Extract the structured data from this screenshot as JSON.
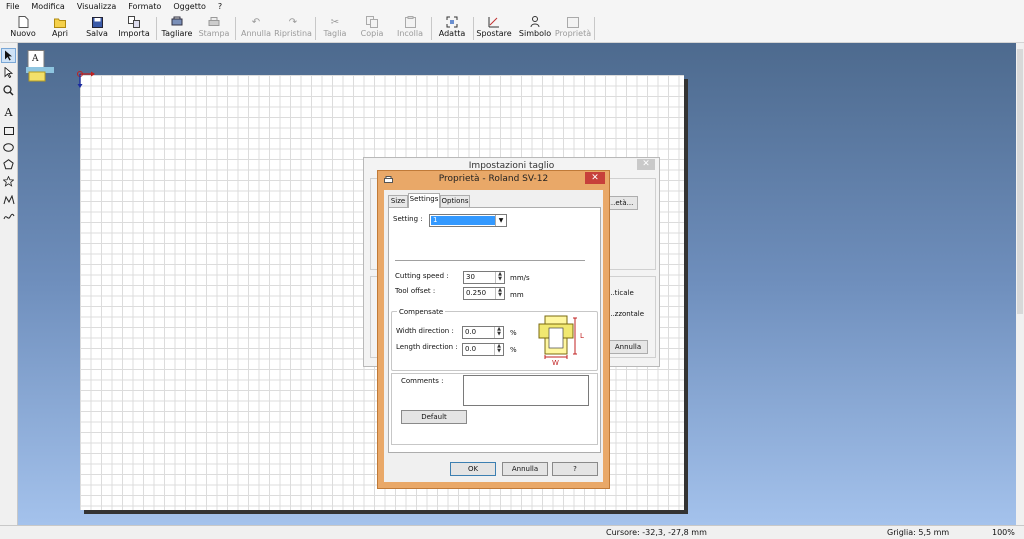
{
  "menu": [
    "File",
    "Modifica",
    "Visualizza",
    "Formato",
    "Oggetto",
    "?"
  ],
  "toolbar": {
    "nuovo": "Nuovo",
    "apri": "Apri",
    "salva": "Salva",
    "importa": "Importa",
    "tagliare": "Tagliare",
    "stampa": "Stampa",
    "annulla": "Annulla",
    "ripristina": "Ripristina",
    "taglia": "Taglia",
    "copia": "Copia",
    "incolla": "Incolla",
    "adatta": "Adatta",
    "spostare": "Spostare",
    "simbolo": "Simbolo",
    "proprieta": "Proprietà"
  },
  "left_tools": [
    "select-arrow-icon",
    "node-edit-icon",
    "zoom-icon",
    "text-icon",
    "rectangle-icon",
    "ellipse-icon",
    "polygon-icon",
    "star-icon",
    "bezier-icon",
    "freehand-icon"
  ],
  "back_dialog": {
    "title": "Impostazioni taglio",
    "close": "✕",
    "properties_button": "...età...",
    "vertical_label": "...ticale",
    "horizontal_label": "...zzontale",
    "cancel_button": "Annulla"
  },
  "front_dialog": {
    "title": "Proprietà - Roland SV-12",
    "close": "✕",
    "tabs": [
      "Size",
      "Settings",
      "Options"
    ],
    "setting_label": "Setting :",
    "setting_value": "1",
    "cutting_speed_label": "Cutting speed :",
    "cutting_speed_value": "30",
    "cutting_speed_unit": "mm/s",
    "tool_offset_label": "Tool offset :",
    "tool_offset_value": "0.250",
    "tool_offset_unit": "mm",
    "compensate_label": "Compensate",
    "width_direction_label": "Width direction :",
    "width_direction_value": "0.0",
    "width_unit": "%",
    "length_direction_label": "Length direction :",
    "length_direction_value": "0.0",
    "length_unit": "%",
    "diagram_l": "L",
    "diagram_w": "W",
    "comments_label": "Comments :",
    "default_button": "Default",
    "ok_button": "OK",
    "cancel_button": "Annulla",
    "help_button": "?"
  },
  "status": {
    "cursor": "Cursore: -32,3, -27,8 mm",
    "grid": "Griglia: 5,5 mm",
    "zoom": "100%"
  },
  "colors": {
    "accent_orange": "#e9a868",
    "close_red": "#c7403a",
    "selection_blue": "#3399ff"
  }
}
